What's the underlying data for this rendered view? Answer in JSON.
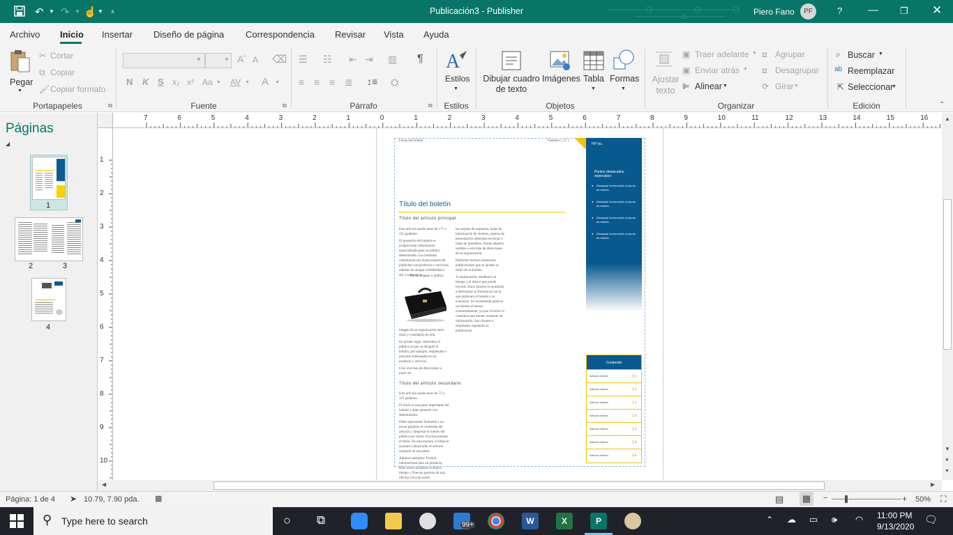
{
  "app": {
    "title": "Publicación3  -  Publisher",
    "user_name": "Piero Fano",
    "user_initials": "PF",
    "help": "?"
  },
  "menu_tabs": [
    "Archivo",
    "Inicio",
    "Insertar",
    "Diseño de página",
    "Correspondencia",
    "Revisar",
    "Vista",
    "Ayuda"
  ],
  "ribbon": {
    "groups": [
      "Portapapeles",
      "Fuente",
      "Párrafo",
      "Estilos",
      "Objetos",
      "Organizar",
      "Edición"
    ],
    "paste": "Pegar",
    "cut": "Cortar",
    "copy": "Copiar",
    "format_painter": "Copiar formato",
    "styles": "Estilos",
    "draw_textbox": "Dibujar cuadro de texto",
    "images": "Imágenes",
    "table": "Tabla",
    "shapes": "Formas",
    "wrap_text": "Ajustar texto",
    "bring_forward": "Traer adelante",
    "send_backward": "Enviar atrás",
    "align": "Alinear",
    "group": "Agrupar",
    "ungroup": "Desagrupar",
    "rotate": "Girar",
    "find": "Buscar",
    "replace": "Reemplazar",
    "select": "Seleccionar",
    "font_buttons": [
      "N",
      "K",
      "S",
      "x₂",
      "x²",
      "Aa",
      "AV",
      "A"
    ]
  },
  "pages_pane": {
    "title": "Páginas",
    "thumbs": [
      "1",
      "2",
      "3",
      "4"
    ]
  },
  "ruler": {
    "h_labels": [
      "7",
      "6",
      "5",
      "4",
      "3",
      "2",
      "1",
      "0",
      "1",
      "2",
      "3",
      "4",
      "5",
      "6",
      "7",
      "8",
      "9",
      "10",
      "11",
      "12",
      "13",
      "14",
      "15",
      "16"
    ],
    "v_labels": [
      "1",
      "2",
      "3",
      "4",
      "5",
      "6",
      "7",
      "8",
      "9",
      "10"
    ]
  },
  "document": {
    "header_left": "Fecha del boletín",
    "header_right": "Volumen 1, nº 1",
    "sidebar_org": "HP Inc.",
    "sidebar_heading": "Puntos destacados especiales:",
    "sidebar_bullets": [
      "Destaque brevemente un punto de interés.",
      "Destaque brevemente un punto de interés.",
      "Destaque brevemente un punto de interés.",
      "Destaque brevemente un punto de interés."
    ],
    "newsletter_title": "Título del boletín",
    "main_article_title": "Título del artículo principal",
    "col1_text": [
      "Este artículo puede tener de 175 a 225 palabras.",
      "El propósito del boletín es proporcionar información especializada para un público determinado. Los boletines constituyen una buena manera de publicitar sus productos o servicios, además de otorgar credibilidad y dar a conocer la"
    ],
    "caption": "Pie de imagen o gráfico.",
    "col1_text_after": [
      "imagen de su organización entre otros y consideren de ella.",
      "En primer lugar, determine el público al que va dirigido el boletín, por ejemplo, empleados o personas interesadas en un producto o servicio.",
      "Cree una lista de direcciones a partir de"
    ],
    "col2_text": [
      "las tarjetas de respuesta, hojas de información de clientes, tarjetas de presentación obtenidas en ferias o listas de miembros. Puede adquirir nombre a otra lista de direcciones de su organización.",
      "Publisher incluye numerosas publicaciones que se ajustan al estilo de su boletín.",
      "A continuación, establezca el tiempo y el dinero que puede invertir. Estos factores le ayudarán a determinar la frecuencia con la que publicará el boletín y su extensión. Se recomienda publicar un boletín al menos trimestralmente, ya que el lector lo considera una fuente constante de información. Sus clientes o empleados esperarán su publicación."
    ],
    "secondary_title": "Título del artículo secundario",
    "col1_secondary": [
      "Este artículo puede tener de 75 a 125 palabras.",
      "El título es una parte importante del boletín y debe pensarlo con detenimiento.",
      "Debe representar fielmente y en pocas palabras el contenido del artículo y despertar el interés del público por leerlo. Escriba primero el título. De esta manera, el título le ayudará a desarrollar el artículo centrado en ese punto.",
      "Algunos ejemplos: Premio internacional para un producto, Bien nuevo producto le ahorra tiempo y Nuevas apertura de una oficina cerca de usted."
    ],
    "toc_heading": "Contenido",
    "toc_entries": [
      [
        "Artículo interior",
        "2"
      ],
      [
        "Artículo interior",
        "2"
      ],
      [
        "Artículo interior",
        "2"
      ],
      [
        "Artículo interior",
        "3"
      ],
      [
        "Artículo interior",
        "4"
      ],
      [
        "Artículo interior",
        "5"
      ],
      [
        "Artículo interior",
        "6"
      ]
    ]
  },
  "status": {
    "page": "Página: 1 de 4",
    "coords": "10.79, 7.90 pda.",
    "zoom": "50%"
  },
  "taskbar": {
    "search_placeholder": "Type here to search",
    "mail_badge": "99+",
    "time": "11:00 PM",
    "date": "9/13/2020"
  },
  "colors": {
    "accent": "#077568",
    "doc_blue": "#08598f",
    "doc_yellow": "#f2c200"
  }
}
